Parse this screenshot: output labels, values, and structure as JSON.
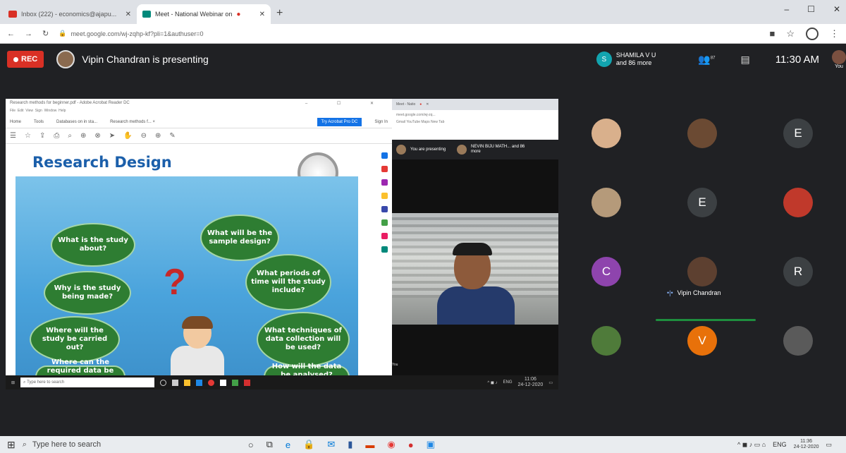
{
  "browser": {
    "tabs": [
      {
        "label": "Inbox (222) - economics@ajapu...",
        "icon": "gmail-icon"
      },
      {
        "label": "Meet - National Webinar on",
        "icon": "meet-icon",
        "active": true
      }
    ],
    "url": "meet.google.com/wj-zqhp-kf?pli=1&authuser=0",
    "window_controls": [
      "–",
      "☐",
      "✕"
    ]
  },
  "meet": {
    "rec_label": "REC",
    "presenting_text": "Vipin Chandran is presenting",
    "participants_summary": {
      "name": "SHAMILA V U",
      "more": "and 86 more",
      "initial": "S"
    },
    "people_badge": "87",
    "time": "11:30 AM",
    "you_label": "You"
  },
  "shared_screen": {
    "acrobat": {
      "title": "Research methods for beginner.pdf - Adobe Acrobat Reader DC",
      "menu": [
        "File",
        "Edit",
        "View",
        "Sign",
        "Window",
        "Help"
      ],
      "tabs": [
        "Home",
        "Tools",
        "Databases on in sta...",
        "Research methods f...  ×"
      ],
      "try_button": "Try Acrobat Pro DC",
      "sign_in": "Sign In"
    },
    "slide": {
      "title": "Research Design",
      "clouds": [
        "What is the study about?",
        "What will be the sample design?",
        "What periods of time will the study include?",
        "Why is the study being made?",
        "Where will the study be carried out?",
        "What techniques of data collection will be used?",
        "Where can the required data be found?",
        "How will the data be analysed?"
      ],
      "question_mark": "?"
    },
    "inner_browser": {
      "tab": "Meet - Natio",
      "url": "meet.google.com/wj-zq...",
      "bookmarks": "Gmail  YouTube  Maps  New Tab",
      "you_are_presenting": "You are presenting",
      "other": "NEVIN BIJU MATH... and 86 more",
      "you_label": "You"
    },
    "inner_taskbar": {
      "search_placeholder": "Type here to search",
      "clock": "11:06",
      "date": "24-12-2020",
      "lang": "ENG"
    }
  },
  "tiles": [
    {
      "name": "",
      "initial": "",
      "color": "#d9b08c"
    },
    {
      "name": "",
      "initial": "",
      "color": "#6b4a33"
    },
    {
      "name": "",
      "initial": "E",
      "color": "#3c4043"
    },
    {
      "name": "",
      "initial": "",
      "color": "#b59a7a"
    },
    {
      "name": "",
      "initial": "E",
      "color": "#3c4043"
    },
    {
      "name": "",
      "initial": "",
      "color": "#c0392b"
    },
    {
      "name": "",
      "initial": "C",
      "color": "#8e44ad"
    },
    {
      "name": "Vipin Chandran",
      "initial": "",
      "color": "#5d4030"
    },
    {
      "name": "",
      "initial": "R",
      "color": "#3c4043"
    },
    {
      "name": "",
      "initial": "",
      "color": "#4f7b3a"
    },
    {
      "name": "",
      "initial": "V",
      "color": "#e8710a"
    },
    {
      "name": "",
      "initial": "",
      "color": "#5a5a5a"
    }
  ],
  "taskbar": {
    "search_placeholder": "Type here to search",
    "clock": "11:36",
    "date": "24-12-2020",
    "lang": "ENG"
  }
}
